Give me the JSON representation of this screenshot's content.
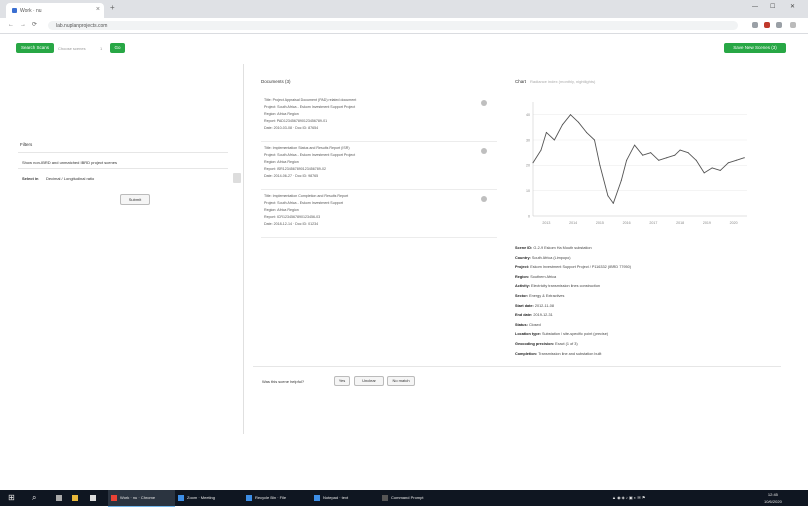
{
  "browser": {
    "tab_title": "Work · nu",
    "tab_close": "×",
    "new_tab": "+",
    "url": "lab.nuplanprojects.com",
    "nav": {
      "back": "←",
      "forward": "→",
      "reload": "⟳"
    },
    "window": {
      "minimize": "—",
      "maximize": "☐",
      "close": "✕"
    }
  },
  "toolbar": {
    "left_button": "Search Scans",
    "left_label": "Choose scenes",
    "left_count": "1",
    "go_button": "Go",
    "right_button": "Save New Scenes (3)"
  },
  "filters": {
    "title": "Filters",
    "row1": "Show non-IBRD and unmatched IBRD project scenes",
    "row2_label": "Select in",
    "row2_value": "Decimal / Longitudinal ratio",
    "submit": "Submit"
  },
  "documents": {
    "title": "Documents (3)",
    "items": [
      {
        "l1": "Title: Project Appraisal Document (PAD) related document",
        "l2": "Project: South Africa - Eskom Investment Support Project",
        "l3": "Region: Africa Region",
        "l4": "Report: PAD1234567890123456789-01",
        "l5": "Date: 2010-03-08 · Doc ID: 87654"
      },
      {
        "l1": "Title: Implementation Status and Results Report (ISR)",
        "l2": "Project: South Africa - Eskom Investment Support Project",
        "l3": "Region: Africa Region",
        "l4": "Report: ISR1234567890123456789-02",
        "l5": "Date: 2014-06-27 · Doc ID: 98765"
      },
      {
        "l1": "Title: Implementation Completion and Results Report",
        "l2": "Project: South Africa - Eskom Investment Support",
        "l3": "Region: Africa Region",
        "l4": "Report: ICR1234567890123456-03",
        "l5": "Date: 2018-12-14 · Doc ID: 01234"
      }
    ]
  },
  "chart": {
    "title": "Chart",
    "subtitle": "Radiance index (monthly, nightlights)",
    "y_ticks": [
      "40",
      "30",
      "20",
      "10",
      "0"
    ],
    "x_ticks": [
      "2013",
      "2014",
      "2015",
      "2016",
      "2017",
      "2018",
      "2019",
      "2020"
    ]
  },
  "chart_data": {
    "type": "line",
    "x": [
      2012.5,
      2012.8,
      2013.0,
      2013.3,
      2013.6,
      2013.9,
      2014.2,
      2014.5,
      2014.8,
      2015.0,
      2015.3,
      2015.5,
      2015.8,
      2016.0,
      2016.3,
      2016.6,
      2016.9,
      2017.2,
      2017.5,
      2017.8,
      2018.0,
      2018.3,
      2018.6,
      2018.9,
      2019.2,
      2019.5,
      2019.8,
      2020.1,
      2020.4
    ],
    "series": [
      {
        "values": [
          21,
          26,
          33,
          30,
          36,
          40,
          37,
          33,
          30,
          20,
          8,
          5,
          14,
          22,
          28,
          24,
          25,
          22,
          23,
          24,
          26,
          25,
          22,
          17,
          19,
          18,
          21,
          22,
          23
        ]
      }
    ],
    "ylim": [
      0,
      45
    ],
    "xlim": [
      2012.5,
      2020.5
    ],
    "grid": true
  },
  "metadata": {
    "rows": [
      {
        "k": "Scene ID:",
        "v": "G-2-9 Eskom Ha Mouth substation"
      },
      {
        "k": "Country:",
        "v": "South Africa (Limpopo)"
      },
      {
        "k": "Project:",
        "v": "Eskom Investment Support Project / P116332 (IBRD 77950)"
      },
      {
        "k": "Region:",
        "v": "Southern Africa"
      },
      {
        "k": "Activity:",
        "v": "Electricity transmission lines construction"
      },
      {
        "k": "Sector:",
        "v": "Energy & Extractives"
      },
      {
        "k": "Start date:",
        "v": "2012-11-08"
      },
      {
        "k": "End date:",
        "v": "2019-12-31"
      },
      {
        "k": "Status:",
        "v": "Closed"
      },
      {
        "k": "Location type:",
        "v": "Substation / site-specific point (precise)"
      },
      {
        "k": "Geocoding precision:",
        "v": "Exact (1 of 3)"
      },
      {
        "k": "Completion:",
        "v": "Transmission line and substation built"
      }
    ]
  },
  "bottom": {
    "label": "Was this scene helpful?",
    "buttons": [
      "Yes",
      "Unclear",
      "No match"
    ]
  },
  "taskbar": {
    "start": "⊞",
    "search": "⌕",
    "items": [
      "Work · nu · Chrome",
      "Zoom · Meeting",
      "Recycle Bin · File",
      "Notepad · text",
      "Command Prompt"
    ],
    "time": "12:45",
    "date": "10/6/2020"
  }
}
